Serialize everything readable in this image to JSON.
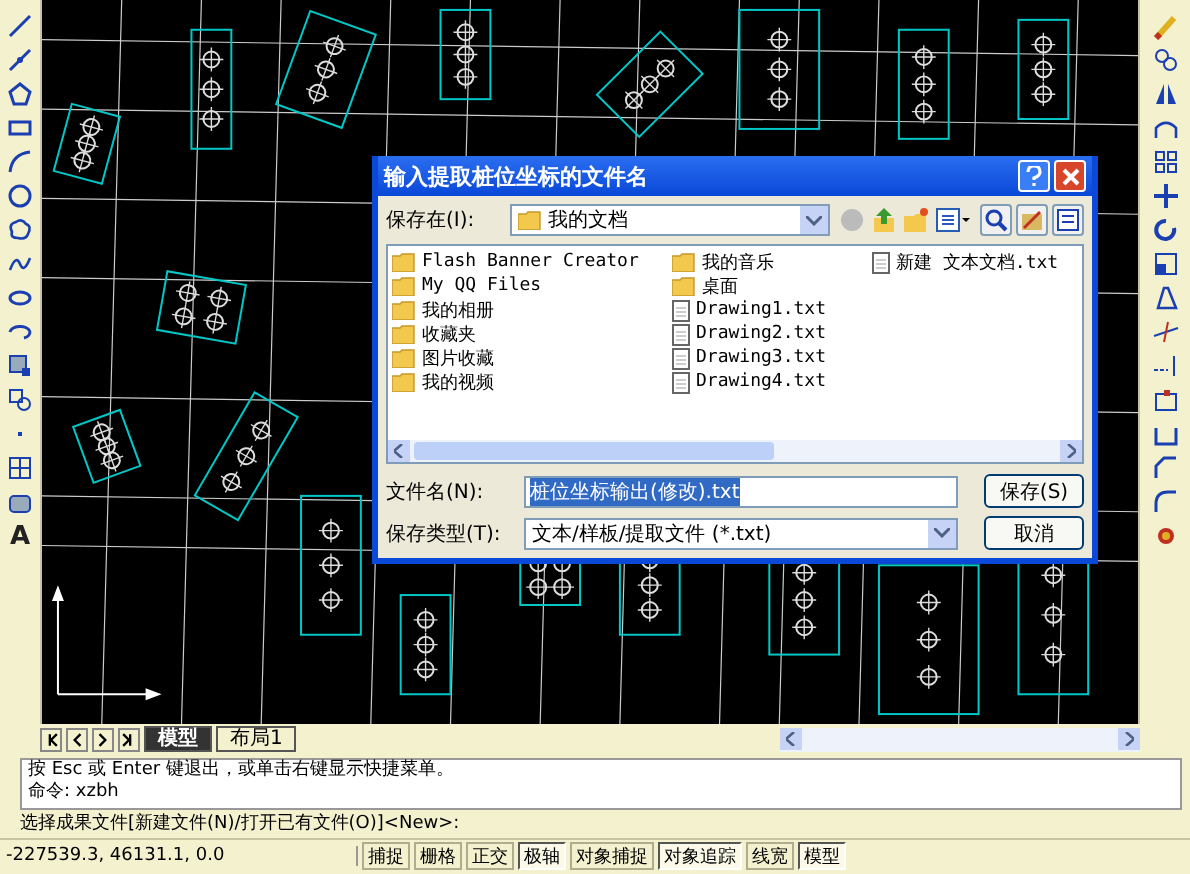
{
  "dialog": {
    "title": "输入提取桩位坐标的文件名",
    "save_in": {
      "label": "保存在(I):",
      "value": "我的文档"
    },
    "files": [
      {
        "name": "Flash Banner Creator",
        "kind": "folder"
      },
      {
        "name": "My QQ Files",
        "kind": "folder"
      },
      {
        "name": "我的相册",
        "kind": "folder"
      },
      {
        "name": "收藏夹",
        "kind": "folder"
      },
      {
        "name": "图片收藏",
        "kind": "folder"
      },
      {
        "name": "我的视频",
        "kind": "folder"
      },
      {
        "name": "我的音乐",
        "kind": "folder"
      },
      {
        "name": "桌面",
        "kind": "folder"
      },
      {
        "name": "Drawing1.txt",
        "kind": "file"
      },
      {
        "name": "Drawing2.txt",
        "kind": "file"
      },
      {
        "name": "Drawing3.txt",
        "kind": "file"
      },
      {
        "name": "Drawing4.txt",
        "kind": "file"
      },
      {
        "name": "新建 文本文档.txt",
        "kind": "file"
      }
    ],
    "file_name": {
      "label": "文件名(N):",
      "value": "桩位坐标输出(修改).txt"
    },
    "file_type": {
      "label": "保存类型(T):",
      "value": "文本/样板/提取文件 (*.txt)"
    },
    "buttons": [
      "保存(S)",
      "取消"
    ]
  },
  "draw_toolbar": {
    "text_tool": "A"
  },
  "layout_tabs": [
    {
      "label": "模型",
      "selected": true
    },
    {
      "label": "布局1",
      "selected": false
    }
  ],
  "command_lines": [
    "按 Esc 或 Enter 键退出，或单击右键显示快捷菜单。",
    "命令: xzbh"
  ],
  "prompt": "选择成果文件[新建文件(N)/打开已有文件(O)]<New>:",
  "status_bar": {
    "coordinates": "-227539.3, 46131.1, 0.0",
    "toggles": [
      {
        "label": "捕捉",
        "on": false
      },
      {
        "label": "栅格",
        "on": false
      },
      {
        "label": "正交",
        "on": false
      },
      {
        "label": "极轴",
        "on": true
      },
      {
        "label": "对象捕捉",
        "on": false
      },
      {
        "label": "对象追踪",
        "on": true
      },
      {
        "label": "线宽",
        "on": false
      },
      {
        "label": "模型",
        "on": true
      }
    ]
  }
}
